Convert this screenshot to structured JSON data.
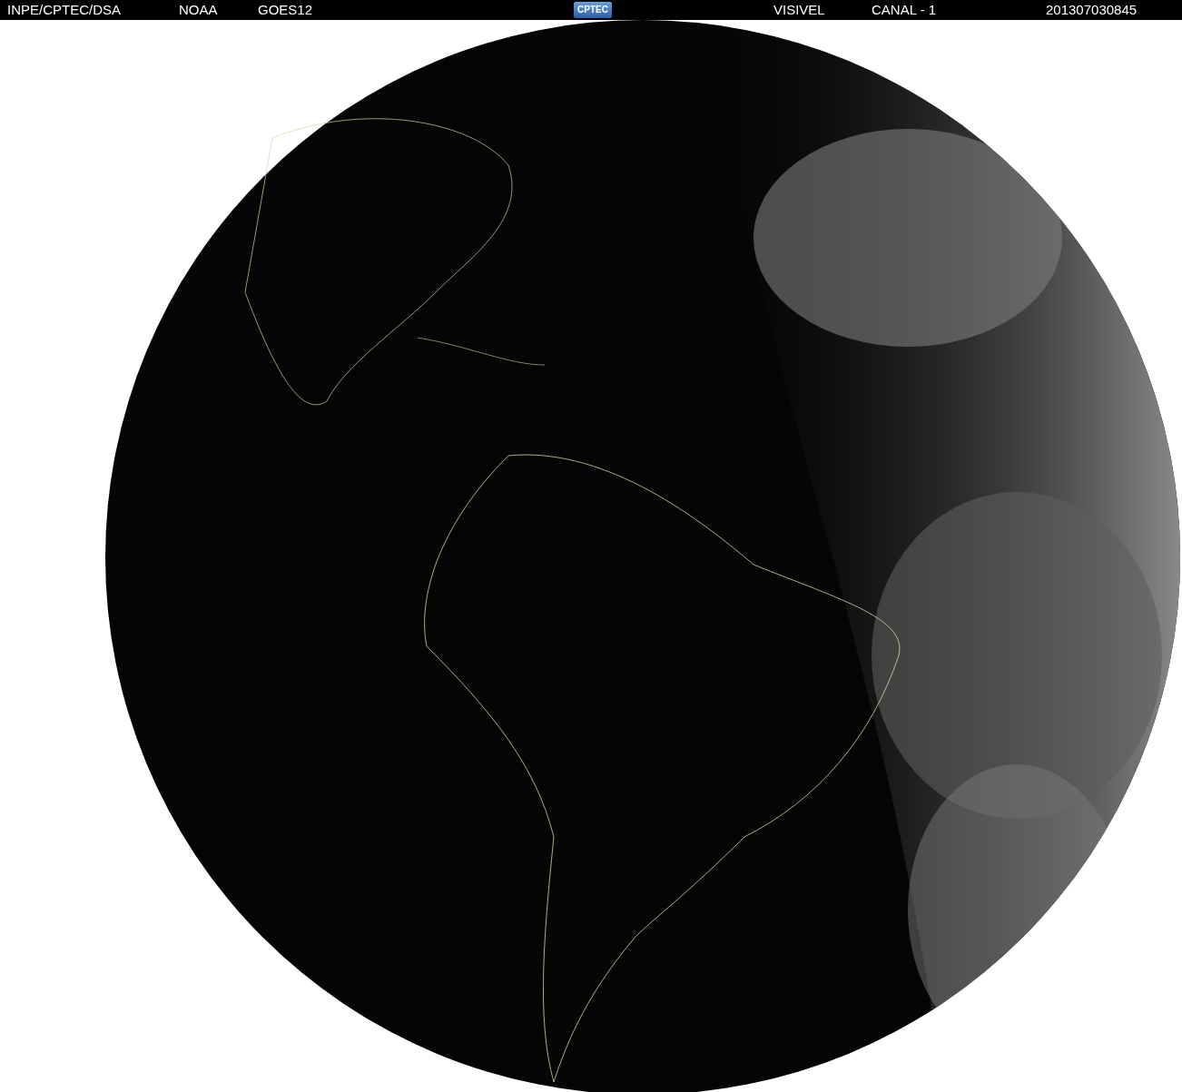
{
  "header": {
    "items": [
      {
        "kind": "text",
        "text": "INPE/CPTEC/DSA"
      },
      {
        "kind": "text",
        "text": "NOAA"
      },
      {
        "kind": "text",
        "text": "GOES12"
      },
      {
        "kind": "logo",
        "text": "CPTEC"
      },
      {
        "kind": "text",
        "text": "VISIVEL"
      },
      {
        "kind": "text",
        "text": "CANAL - 1"
      },
      {
        "kind": "text",
        "text": "201307030845"
      }
    ]
  }
}
